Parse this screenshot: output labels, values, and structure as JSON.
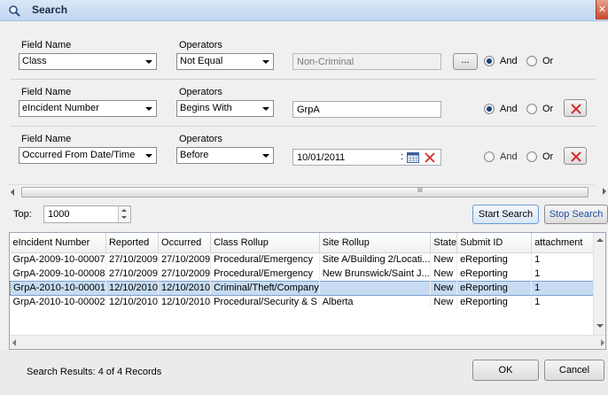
{
  "window": {
    "title": "Search"
  },
  "labels": {
    "field_name": "Field Name",
    "operators": "Operators",
    "and": "And",
    "or": "Or"
  },
  "criteria": [
    {
      "field": "Class",
      "operator": "Not Equal",
      "value": "Non-Criminal",
      "value_disabled": true,
      "logic": "And",
      "has_ellipsis": true,
      "ellipsis_label": "..."
    },
    {
      "field": "eIncident Number",
      "operator": "Begins With",
      "value": "GrpA",
      "logic": "And"
    },
    {
      "field": "Occurred From Date/Time",
      "operator": "Before",
      "value": "10/01/2011",
      "value_suffix": ":",
      "logic": "none"
    }
  ],
  "scroll_grip": "III",
  "top": {
    "label": "Top:",
    "value": "1000"
  },
  "buttons": {
    "start_search": "Start Search",
    "stop_search": "Stop Search",
    "ok": "OK",
    "cancel": "Cancel"
  },
  "table": {
    "columns": [
      "eIncident Number",
      "Reported",
      "Occurred",
      "Class Rollup",
      "Site Rollup",
      "State",
      "Submit ID",
      "attachment"
    ],
    "rows": [
      [
        "GrpA-2009-10-00007",
        "27/10/2009",
        "27/10/2009",
        "Procedural/Emergency",
        "Site A/Building 2/Locati...",
        "New",
        "eReporting",
        "1"
      ],
      [
        "GrpA-2009-10-00008",
        "27/10/2009",
        "27/10/2009",
        "Procedural/Emergency",
        "New Brunswick/Saint J...",
        "New",
        "eReporting",
        "1"
      ],
      [
        "GrpA-2010-10-00001",
        "12/10/2010",
        "12/10/2010",
        "Criminal/Theft/Company",
        "",
        "New",
        "eReporting",
        "1"
      ],
      [
        "GrpA-2010-10-00002",
        "12/10/2010",
        "12/10/2010",
        "Procedural/Security & S",
        "Alberta",
        "New",
        "eReporting",
        "1"
      ]
    ],
    "selected_row": 2
  },
  "status": "Search Results: 4 of 4 Records",
  "colors": {
    "selection": "#c7dcf2",
    "title_bg": "#c2d6ef",
    "delete_x": "#d42b2b"
  }
}
